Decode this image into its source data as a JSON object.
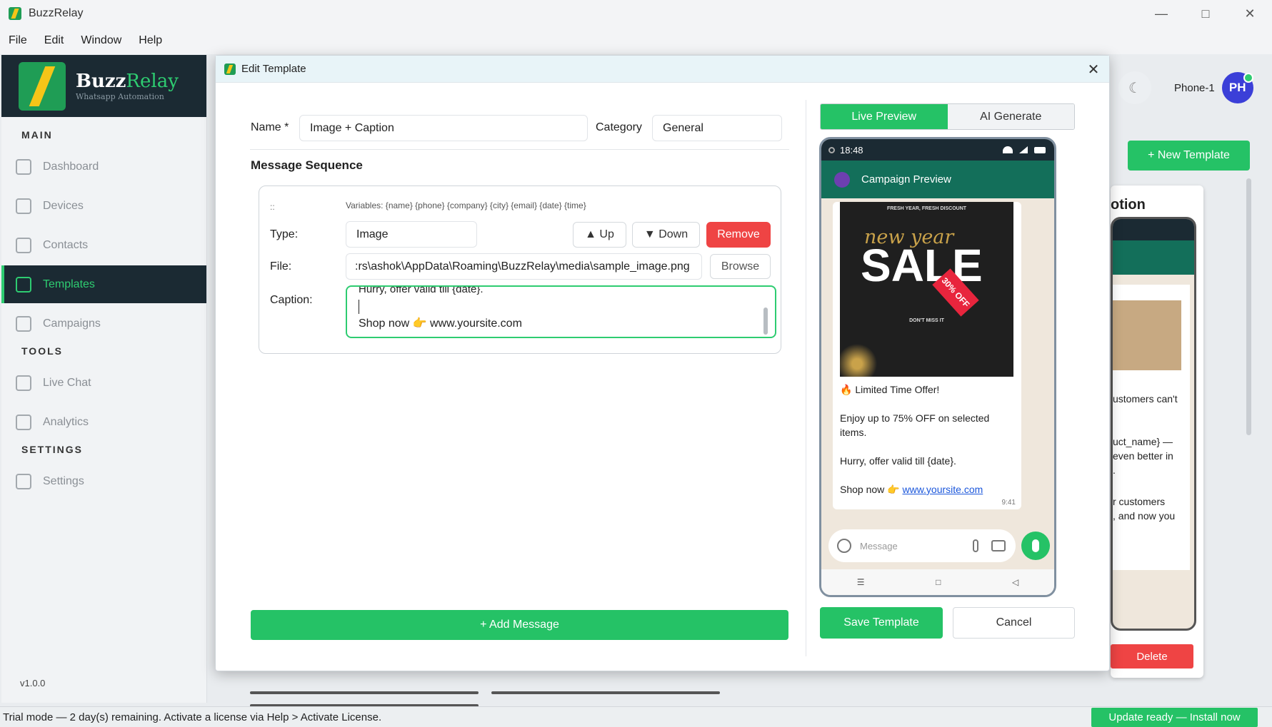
{
  "window": {
    "title": "BuzzRelay",
    "controls": [
      "—",
      "□",
      "✕"
    ]
  },
  "menu": [
    "File",
    "Edit",
    "Window",
    "Help"
  ],
  "sidebar": {
    "brand_name_1": "Buzz",
    "brand_name_2": "Relay",
    "brand_tagline": "Whatsapp Automation",
    "section_main": "MAIN",
    "section_tools": "TOOLS",
    "section_settings": "SETTINGS",
    "items": [
      {
        "label": "Dashboard",
        "icon": "grid-icon"
      },
      {
        "label": "Devices",
        "icon": "phone-icon"
      },
      {
        "label": "Contacts",
        "icon": "user-icon"
      },
      {
        "label": "Templates",
        "icon": "document-icon",
        "active": true
      },
      {
        "label": "Campaigns",
        "icon": "megaphone-icon"
      },
      {
        "label": "Live Chat",
        "icon": "chat-icon"
      },
      {
        "label": "Analytics",
        "icon": "bar-chart-icon"
      },
      {
        "label": "Settings",
        "icon": "gear-icon"
      }
    ],
    "version": "v1.0.0"
  },
  "background": {
    "phone_label": "Phone-1",
    "avatar_initials": "PH",
    "new_template_label": "+ New Template",
    "card_title": "otion",
    "card_text_1": "ustomers can't",
    "card_text_2": "uct_name} —",
    "card_text_3": "even better in",
    "card_text_4": ".",
    "card_text_5": "r customers",
    "card_text_6": ", and now you",
    "delete_label": "Delete"
  },
  "modal": {
    "title": "Edit Template",
    "name_label": "Name *",
    "name_value": "Image + Caption",
    "category_label": "Category",
    "category_value": "General",
    "sequence_title": "Message Sequence",
    "grip": "::",
    "variables_hint": "Variables: {name} {phone} {company} {city} {email} {date} {time}",
    "type_label": "Type:",
    "type_value": "Image",
    "up_label": "▲ Up",
    "down_label": "▼ Down",
    "remove_label": "Remove",
    "file_label": "File:",
    "file_value": ":rs\\ashok\\AppData\\Roaming\\BuzzRelay\\media\\sample_image.png",
    "browse_label": "Browse",
    "caption_label": "Caption:",
    "caption_line_1": "Hurry, offer valid till {date}.",
    "caption_line_3": "Shop now 👉 www.yoursite.com",
    "add_message_label": "+ Add Message"
  },
  "preview": {
    "tab_live": "Live Preview",
    "tab_ai": "AI Generate",
    "status_time": "18:48",
    "chat_title": "Campaign Preview",
    "img_top": "FRESH YEAR, FRESH DISCOUNT",
    "img_script": "new year",
    "img_sale": "SALE",
    "img_tag": "30% OFF",
    "img_bottom": "DON'T MISS IT",
    "line_1": "🔥 Limited Time Offer!",
    "line_2": "Enjoy up to 75% OFF on selected items.",
    "line_3": "Hurry, offer valid till {date}.",
    "line_4_prefix": "Shop now 👉 ",
    "line_4_link": "www.yoursite.com",
    "msg_time": "9:41",
    "input_placeholder": "Message",
    "nav_menu": "☰",
    "nav_home": "□",
    "nav_back": "◁",
    "save_label": "Save Template",
    "cancel_label": "Cancel"
  },
  "status": {
    "message": "Trial mode — 2 day(s) remaining. Activate a license via Help > Activate License.",
    "update_label": "Update ready — Install now"
  },
  "colors": {
    "accent": "#25c266",
    "brand_dark": "#1b2a33",
    "danger": "#ef4444",
    "wa_green": "#136f5a"
  }
}
